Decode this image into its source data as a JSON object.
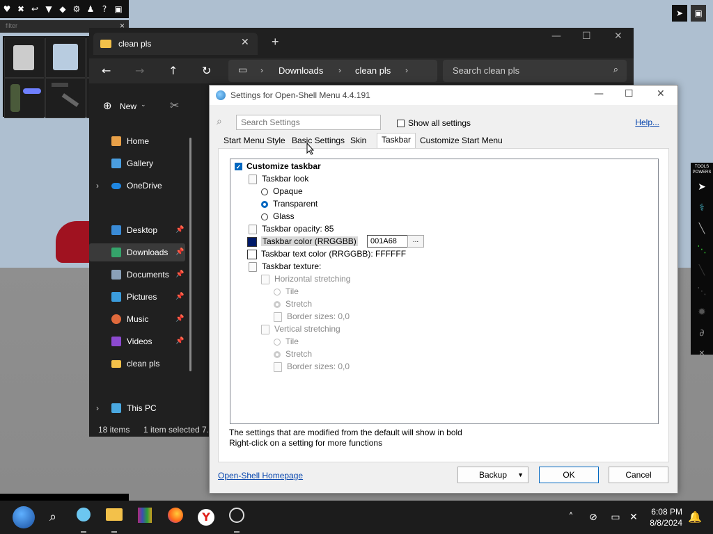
{
  "game": {
    "toolbar_icons": [
      "♥",
      "✖",
      "↩",
      "▼",
      "◆",
      "⚙",
      "♟",
      "?",
      "▣"
    ],
    "filter_placeholder": "filter",
    "tools_label": "TOOLS",
    "powers_label": "POWERS"
  },
  "explorer": {
    "tab_title": "clean pls",
    "new_tab": "+",
    "breadcrumb": [
      "Downloads",
      "clean pls"
    ],
    "search_placeholder": "Search clean pls",
    "new_label": "New",
    "sidebar": [
      {
        "label": "Home",
        "color": "#e8a048",
        "pinned": false,
        "expander": false
      },
      {
        "label": "Gallery",
        "color": "#4a9ee0",
        "pinned": false,
        "expander": false
      },
      {
        "label": "OneDrive",
        "color": "#1f86e0",
        "pinned": false,
        "expander": true
      },
      {
        "label": "Desktop",
        "color": "#3a8bd6",
        "pinned": true,
        "expander": false
      },
      {
        "label": "Downloads",
        "color": "#35a46b",
        "pinned": true,
        "expander": false,
        "selected": true
      },
      {
        "label": "Documents",
        "color": "#8aa0b8",
        "pinned": true,
        "expander": false
      },
      {
        "label": "Pictures",
        "color": "#3b9cdc",
        "pinned": true,
        "expander": false
      },
      {
        "label": "Music",
        "color": "#e06a3c",
        "pinned": true,
        "expander": false
      },
      {
        "label": "Videos",
        "color": "#8c4ad0",
        "pinned": true,
        "expander": false
      },
      {
        "label": "clean pls",
        "color": "#f3c14a",
        "pinned": false,
        "expander": false
      },
      {
        "label": "This PC",
        "color": "#4aa8e0",
        "pinned": false,
        "expander": true
      }
    ],
    "status_items": "18 items",
    "status_selected": "1 item selected",
    "status_extra": "7."
  },
  "dialog": {
    "title": "Settings for Open-Shell Menu 4.4.191",
    "search_placeholder": "Search Settings",
    "show_all_label": "Show all settings",
    "help_link": "Help...",
    "tabs": [
      "Start Menu Style",
      "Basic Settings",
      "Skin",
      "Taskbar",
      "Customize Start Menu"
    ],
    "active_tab": "Taskbar",
    "tree": {
      "customize_taskbar": "Customize taskbar",
      "taskbar_look": "Taskbar look",
      "opaque": "Opaque",
      "transparent": "Transparent",
      "glass": "Glass",
      "opacity": "Taskbar opacity: 85",
      "color_label": "Taskbar color (RRGGBB)",
      "color_value": "001A68",
      "color_hex": "#001A68",
      "color_btn": "...",
      "text_color": "Taskbar text color (RRGGBB): FFFFFF",
      "texture": "Taskbar texture:",
      "horizontal": "Horizontal stretching",
      "h_tile": "Tile",
      "h_stretch": "Stretch",
      "h_border": "Border sizes: 0,0",
      "vertical": "Vertical stretching",
      "v_tile": "Tile",
      "v_stretch": "Stretch",
      "v_border": "Border sizes: 0,0"
    },
    "note1": "The settings that are modified from the default will show in bold",
    "note2": "Right-click on a setting for more functions",
    "homepage_link": "Open-Shell Homepage",
    "backup": "Backup",
    "ok": "OK",
    "cancel": "Cancel"
  },
  "taskbar": {
    "time": "6:08 PM",
    "date": "8/8/2024"
  }
}
